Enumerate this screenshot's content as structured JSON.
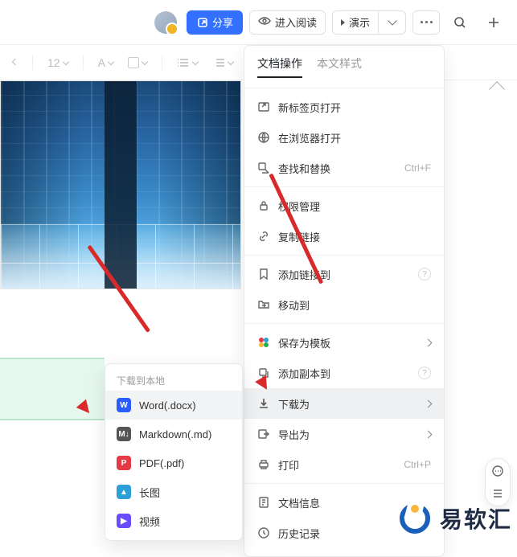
{
  "topbar": {
    "share": "分享",
    "reading": "进入阅读",
    "present": "演示"
  },
  "toolbar": {
    "font_size": "12"
  },
  "menu": {
    "tab_doc": "文档操作",
    "tab_style": "本文样式",
    "items": {
      "new_tab": "新标签页打开",
      "open_browser": "在浏览器打开",
      "find_replace": "查找和替换",
      "find_hint": "Ctrl+F",
      "permissions": "权限管理",
      "copy_link": "复制链接",
      "add_link_to": "添加链接到",
      "move_to": "移动到",
      "save_template": "保存为模板",
      "add_copy_to": "添加副本到",
      "download_as": "下载为",
      "export_as": "导出为",
      "print": "打印",
      "print_hint": "Ctrl+P",
      "doc_info": "文档信息",
      "history": "历史记录"
    }
  },
  "submenu": {
    "title": "下载到本地",
    "word": "Word(.docx)",
    "markdown": "Markdown(.md)",
    "pdf": "PDF(.pdf)",
    "image": "长图",
    "video": "视频"
  },
  "watermark": "易软汇"
}
